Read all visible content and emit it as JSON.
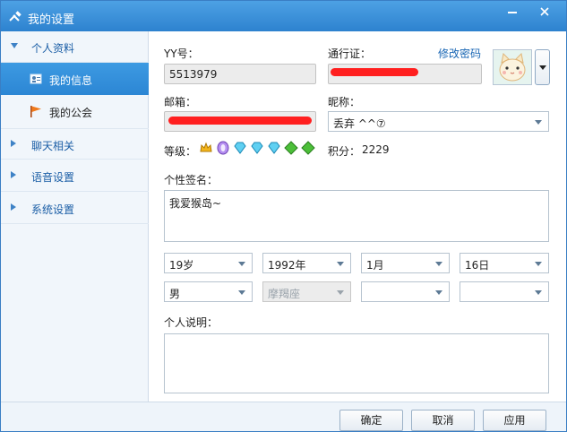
{
  "window": {
    "title": "我的设置",
    "icon": "tools-icon"
  },
  "sidebar": {
    "sections": [
      {
        "label": "个人资料",
        "expanded": true
      },
      {
        "label": "聊天相关",
        "expanded": false
      },
      {
        "label": "语音设置",
        "expanded": false
      },
      {
        "label": "系统设置",
        "expanded": false
      }
    ],
    "sub_items": [
      {
        "label": "我的信息",
        "icon": "id-card-icon",
        "active": true
      },
      {
        "label": "我的公会",
        "icon": "flag-icon",
        "active": false
      }
    ]
  },
  "profile": {
    "yy_label": "YY号：",
    "yy_value": "5513979",
    "passport_label": "通行证：",
    "change_password_link": "修改密码",
    "passport_value": "",
    "email_label": "邮箱：",
    "email_value": "",
    "nickname_label": "昵称：",
    "nickname_value": "丢弃 ^^⑦",
    "level_label": "等级：",
    "level_badges": [
      "crown-icon",
      "purple-gem-icon",
      "blue-diamond-icon",
      "blue-diamond-icon",
      "blue-diamond-icon",
      "green-diamond-icon",
      "green-diamond-icon"
    ],
    "points_label": "积分：",
    "points_value": "2229",
    "signature_label": "个性签名：",
    "signature_value": "我爱猴岛~",
    "age": "19岁",
    "birth_year": "1992年",
    "birth_month": "1月",
    "birth_day": "16日",
    "gender": "男",
    "zodiac": "摩羯座",
    "region1": "",
    "region2": "",
    "description_label": "个人说明：",
    "description_value": ""
  },
  "footer": {
    "ok_label": "确定",
    "cancel_label": "取消",
    "apply_label": "应用"
  },
  "colors": {
    "titlebar": "#2d82cf",
    "active_nav": "#2c86d4",
    "link": "#1866b4",
    "redaction": "#ff1f1f"
  }
}
